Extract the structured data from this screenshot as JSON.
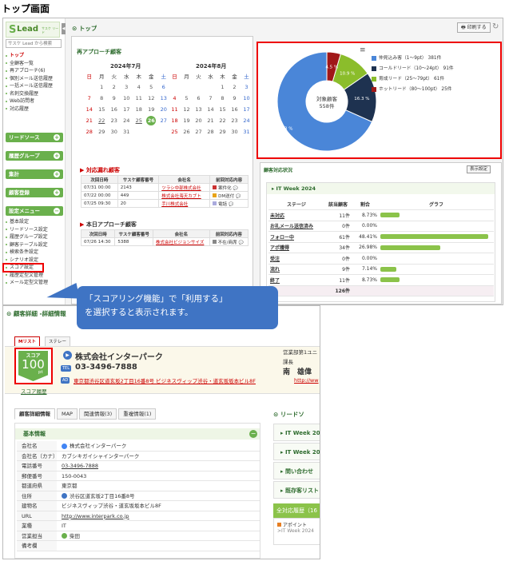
{
  "page_title": "トップ画面",
  "header": {
    "logo": "Lead",
    "logo_sub": "サスケ リード",
    "search_placeholder": "サスケ Lead から検索",
    "top_title": "トップ",
    "print_button": "印刷する"
  },
  "sidebar": {
    "items": [
      "トップ",
      "全顧客一覧",
      "再アプローチ(6)",
      "個別メール送信履歴",
      "一括メール送信履歴",
      "名刺交換履歴",
      "Web訪問者",
      "対応履歴"
    ],
    "groups": [
      "リードソース",
      "履歴グループ",
      "集計",
      "顧客登録",
      "設定メニュー"
    ],
    "settings": [
      "基本設定",
      "リードソース設定",
      "履歴グループ設定",
      "顧客テーブル設定",
      "検索条件設定",
      "シナリオ設定",
      "スコア設定",
      "履歴定型文管理",
      "メール定型文管理"
    ]
  },
  "reapproach": {
    "title": "再アプローチ顧客",
    "months": [
      "2024年7月",
      "2024年8月"
    ],
    "weekdays": [
      "日",
      "月",
      "火",
      "水",
      "木",
      "金",
      "土"
    ],
    "july": [
      [
        "",
        "1",
        "2",
        "3",
        "4",
        "5",
        "6"
      ],
      [
        "7",
        "8",
        "9",
        "10",
        "11",
        "12",
        "13"
      ],
      [
        "14",
        "15",
        "16",
        "17",
        "18",
        "19",
        "20"
      ],
      [
        "21",
        "22",
        "23",
        "24",
        "25",
        "26",
        "27"
      ],
      [
        "28",
        "29",
        "30",
        "31",
        "",
        "",
        ""
      ]
    ],
    "august": [
      [
        "",
        "",
        "",
        "",
        "1",
        "2",
        "3"
      ],
      [
        "4",
        "5",
        "6",
        "7",
        "8",
        "9",
        "10"
      ],
      [
        "11",
        "12",
        "13",
        "14",
        "15",
        "16",
        "17"
      ],
      [
        "18",
        "19",
        "20",
        "21",
        "22",
        "23",
        "24"
      ],
      [
        "25",
        "26",
        "27",
        "28",
        "29",
        "30",
        "31"
      ]
    ]
  },
  "overdue": {
    "title": "対応漏れ顧客",
    "headers": [
      "次回日時",
      "サスケ顧客番号",
      "会社名",
      "前回対応内容"
    ],
    "rows": [
      [
        "07/31 00:00",
        "2143",
        "ツラシ中部株式会社",
        "案件化"
      ],
      [
        "07/22 00:00",
        "449",
        "株式会社海天カブト",
        "DM送付"
      ],
      [
        "07/25 09:30",
        "20",
        "手川株式会社",
        "電話"
      ]
    ]
  },
  "today": {
    "title": "本日アプローチ顧客",
    "headers": [
      "次回日時",
      "サスケ顧客番号",
      "会社名",
      "前回対応内容"
    ],
    "rows": [
      [
        "07/26 14:30",
        "5388",
        "株式会社ビジョンサイズ",
        "不在/商席"
      ]
    ]
  },
  "chart_data": {
    "type": "pie",
    "center_label": "対象顧客",
    "center_value": "558件",
    "slices": [
      {
        "name": "仲見込み客（1〜9pt）",
        "count": "381件",
        "percent": 68.3,
        "label": "68.3 %",
        "color": "#4a86d8"
      },
      {
        "name": "コールドリード（10〜24pt）",
        "count": "91件",
        "percent": 16.3,
        "label": "16.3 %",
        "color": "#1e3250"
      },
      {
        "name": "育成リード（25〜79pt）",
        "count": "61件",
        "percent": 10.9,
        "label": "10.9 %",
        "color": "#8bbd2b"
      },
      {
        "name": "ホットリード（80〜100pt）",
        "count": "25件",
        "percent": 4.5,
        "label": "4.5 %",
        "color": "#a01818"
      }
    ]
  },
  "status": {
    "title": "顧客対応状況",
    "setting_button": "表示設定",
    "event": "IT Week 2024",
    "headers": [
      "ステージ",
      "該当顧客",
      "割合",
      "グラフ"
    ],
    "rows": [
      {
        "stage": "未対応",
        "count": "11件",
        "pct": "8.73%",
        "ratio": 0.0873
      },
      {
        "stage": "お礼メール送信済み",
        "count": "0件",
        "pct": "0.00%",
        "ratio": 0
      },
      {
        "stage": "フォロー中",
        "count": "61件",
        "pct": "48.41%",
        "ratio": 0.4841
      },
      {
        "stage": "アポ獲得",
        "count": "34件",
        "pct": "26.98%",
        "ratio": 0.2698
      },
      {
        "stage": "受注",
        "count": "0件",
        "pct": "0.00%",
        "ratio": 0
      },
      {
        "stage": "流れ",
        "count": "9件",
        "pct": "7.14%",
        "ratio": 0.0714
      },
      {
        "stage": "終了",
        "count": "11件",
        "pct": "8.73%",
        "ratio": 0.0873
      }
    ],
    "total": "126件"
  },
  "callout": {
    "line1": "「スコアリング機能」で「利用する」",
    "line2": "を選択すると表示されます。"
  },
  "detail": {
    "title": "顧客詳細 -詳細情報",
    "tabs_top": [
      "Mリスト",
      "ステレー"
    ],
    "score_label": "スコア",
    "score_value": "100",
    "score_unit": "pt",
    "score_history": "スコア履歴",
    "company": "株式会社インターパーク",
    "tel": "03-3496-7888",
    "address": "東京都渋谷区道玄坂2丁目16番8号 ビジネスヴィップ渋谷・道玄坂坂本ビル8F",
    "dept": "営業部第1ユニ",
    "position": "課長",
    "person": "南　雄偉",
    "url_short": "http://ww",
    "tabs": [
      "顧客詳細情報",
      "MAP",
      "関連情報(3)",
      "重複情報(1)"
    ],
    "basic_title": "基本情報",
    "fields": [
      [
        "会社名",
        "株式会社インターパーク"
      ],
      [
        "会社名（カナ）",
        "カブシキガイシャインターパーク"
      ],
      [
        "電話番号",
        "03-3496-7888"
      ],
      [
        "郵便番号",
        "150-0043"
      ],
      [
        "都道府県",
        "東京都"
      ],
      [
        "住所",
        "渋谷区道玄坂2丁目16番8号"
      ],
      [
        "建物名",
        "ビジネスヴィップ渋谷・道玄坂坂本ビル8F"
      ],
      [
        "URL",
        "http://www.interpark.co.jp"
      ],
      [
        "業種",
        "IT"
      ],
      [
        "営業担当",
        "柴田"
      ],
      [
        "備考欄",
        ""
      ]
    ],
    "lead_title": "リードソ",
    "lead_items": [
      "IT Week 20",
      "IT Week 20",
      "問い合わせ",
      "既存客リスト"
    ],
    "history_title": "全対応履歴（16",
    "history_items": [
      "アポイント",
      "IT Week 2024"
    ]
  }
}
